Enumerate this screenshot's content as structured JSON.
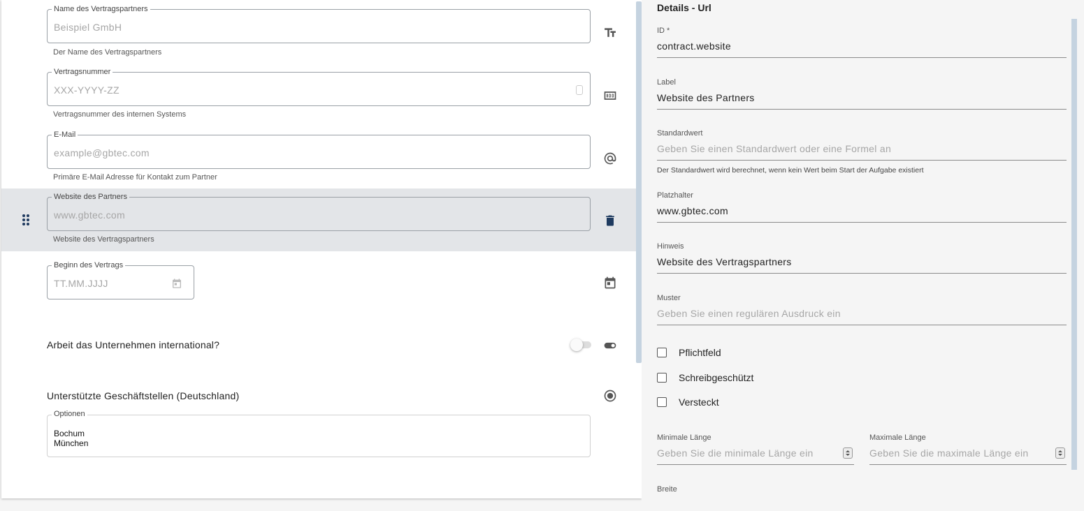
{
  "left": {
    "fields": [
      {
        "legend": "Name des Vertragspartners",
        "placeholder": "Beispiel GmbH",
        "hint": "Der Name des Vertragspartners",
        "icon": "text-fields-icon"
      },
      {
        "legend": "Vertragsnummer",
        "placeholder": "XXX-YYYY-ZZ",
        "hint": "Vertragsnummer des internen Systems",
        "icon": "number-icon"
      },
      {
        "legend": "E-Mail",
        "placeholder": "example@gbtec.com",
        "hint": "Primäre E-Mail Adresse für Kontakt zum Partner",
        "icon": "at-icon"
      },
      {
        "legend": "Website des Partners",
        "placeholder": "www.gbtec.com",
        "hint": "Website des Vertragspartners",
        "icon": "delete-icon"
      },
      {
        "legend": "Beginn des Vertrags",
        "placeholder": "TT.MM.JJJJ",
        "icon": "calendar-icon"
      }
    ],
    "toggle_question": "Arbeit das Unternehmen international?",
    "radio_title": "Unterstützte Geschäftstellen (Deutschland)",
    "options_legend": "Optionen",
    "options": [
      "Bochum",
      "München"
    ]
  },
  "right": {
    "title": "Details - Url",
    "id": {
      "label": "ID *",
      "value": "contract.website"
    },
    "label": {
      "label": "Label",
      "value": "Website des Partners"
    },
    "default": {
      "label": "Standardwert",
      "placeholder": "Geben Sie einen Standardwert oder eine Formel an",
      "hint": "Der Standardwert wird berechnet, wenn kein Wert beim Start der Aufgabe existiert"
    },
    "placeholder": {
      "label": "Platzhalter",
      "value": "www.gbtec.com"
    },
    "hint": {
      "label": "Hinweis",
      "value": "Website des Vertragspartners"
    },
    "pattern": {
      "label": "Muster",
      "placeholder": "Geben Sie einen regulären Ausdruck ein"
    },
    "checkboxes": [
      "Pflichtfeld",
      "Schreibgeschützt",
      "Versteckt"
    ],
    "min_length": {
      "label": "Minimale Länge",
      "placeholder": "Geben Sie die minimale Länge ein"
    },
    "max_length": {
      "label": "Maximale Länge",
      "placeholder": "Geben Sie die maximale Länge ein"
    },
    "width": {
      "label": "Breite"
    }
  }
}
